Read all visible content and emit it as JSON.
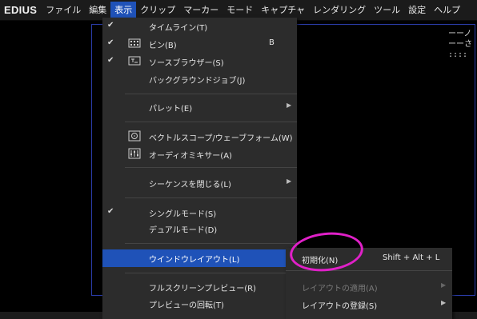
{
  "menubar": {
    "logo": "EDIUS",
    "items": [
      "ファイル",
      "編集",
      "表示",
      "クリップ",
      "マーカー",
      "モード",
      "キャプチャ",
      "レンダリング",
      "ツール",
      "設定",
      "ヘルプ"
    ],
    "active_index": 2
  },
  "view_menu": {
    "items": [
      {
        "label": "タイムライン(T)",
        "checked": true,
        "icon": null,
        "shortcut": "",
        "submenu": false
      },
      {
        "label": "ビン(B)",
        "checked": true,
        "icon": "bin-icon",
        "shortcut": "B",
        "submenu": false
      },
      {
        "label": "ソースブラウザー(S)",
        "checked": true,
        "icon": "source-browser-icon",
        "shortcut": "",
        "submenu": false
      },
      {
        "label": "バックグラウンドジョブ(J)",
        "checked": false,
        "icon": null,
        "shortcut": "",
        "submenu": false
      },
      {
        "label": "パレット(E)",
        "checked": false,
        "icon": null,
        "shortcut": "",
        "submenu": true
      },
      {
        "label": "ベクトルスコープ/ウェーブフォーム(W)",
        "checked": false,
        "icon": "vectorscope-icon",
        "shortcut": "",
        "submenu": false
      },
      {
        "label": "オーディオミキサー(A)",
        "checked": false,
        "icon": "audio-mixer-icon",
        "shortcut": "",
        "submenu": false
      },
      {
        "label": "シーケンスを閉じる(L)",
        "checked": false,
        "icon": null,
        "shortcut": "",
        "submenu": true
      },
      {
        "label": "シングルモード(S)",
        "checked": true,
        "icon": null,
        "shortcut": "",
        "submenu": false
      },
      {
        "label": "デュアルモード(D)",
        "checked": false,
        "icon": null,
        "shortcut": "",
        "submenu": false
      },
      {
        "label": "ウインドウレイアウト(L)",
        "checked": false,
        "icon": null,
        "shortcut": "",
        "submenu": true,
        "highlighted": true
      },
      {
        "label": "フルスクリーンプレビュー(R)",
        "checked": false,
        "icon": null,
        "shortcut": "",
        "submenu": true
      },
      {
        "label": "プレビューの回転(T)",
        "checked": false,
        "icon": null,
        "shortcut": "",
        "submenu": true
      }
    ]
  },
  "layout_submenu": {
    "items": [
      {
        "label": "初期化(N)",
        "shortcut": "Shift + Alt + L",
        "disabled": false,
        "submenu": false
      },
      {
        "label": "レイアウトの適用(A)",
        "shortcut": "",
        "disabled": true,
        "submenu": true
      },
      {
        "label": "レイアウトの登録(S)",
        "shortcut": "",
        "disabled": false,
        "submenu": true
      }
    ]
  },
  "colors": {
    "accent": "#1f52b8",
    "annotation": "#e020c8",
    "menu_bg": "#2c2c2c"
  }
}
